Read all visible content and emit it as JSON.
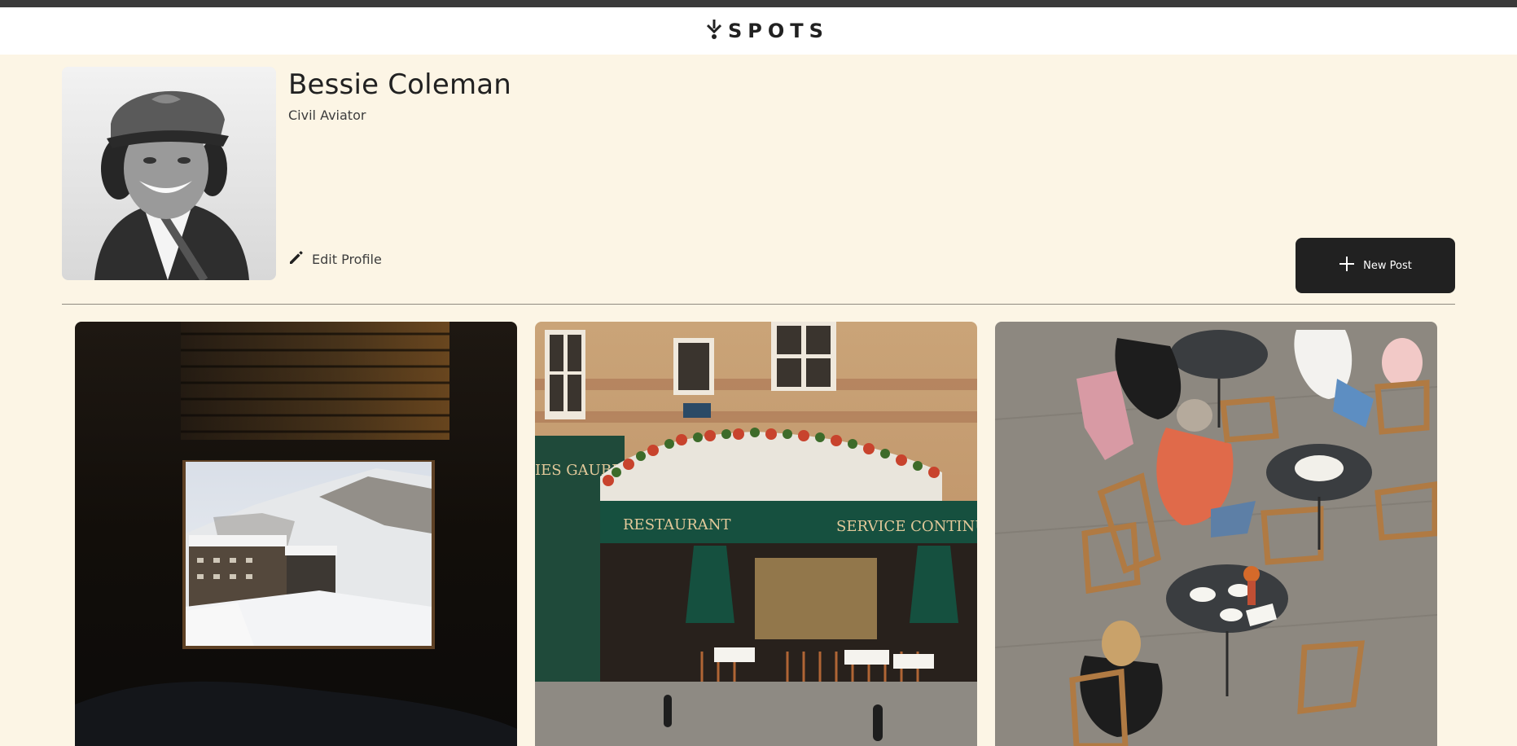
{
  "app": {
    "logo_text": "SPOTS",
    "logo_icon": "pin-drop-icon"
  },
  "profile": {
    "name": "Bessie Coleman",
    "description": "Civil Aviator",
    "edit_label": "Edit Profile",
    "avatar_alt": "Bessie Coleman"
  },
  "actions": {
    "new_post_label": "New Post",
    "new_post_icon": "plus-icon",
    "edit_icon": "pencil-icon"
  },
  "cards": [
    {
      "alt": "Snowy mountain view through window"
    },
    {
      "alt": "Paris restaurant storefront",
      "sign_left": "IES GAUBERT",
      "sign_restaurant": "RESTAURANT",
      "sign_service": "SERVICE CONTINU"
    },
    {
      "alt": "Outdoor cafe terrace from above"
    }
  ],
  "colors": {
    "background": "#FCF5E5",
    "header": "#FFFFFF",
    "topbar": "#3A3A3A",
    "button": "#212121",
    "text": "#212121"
  }
}
